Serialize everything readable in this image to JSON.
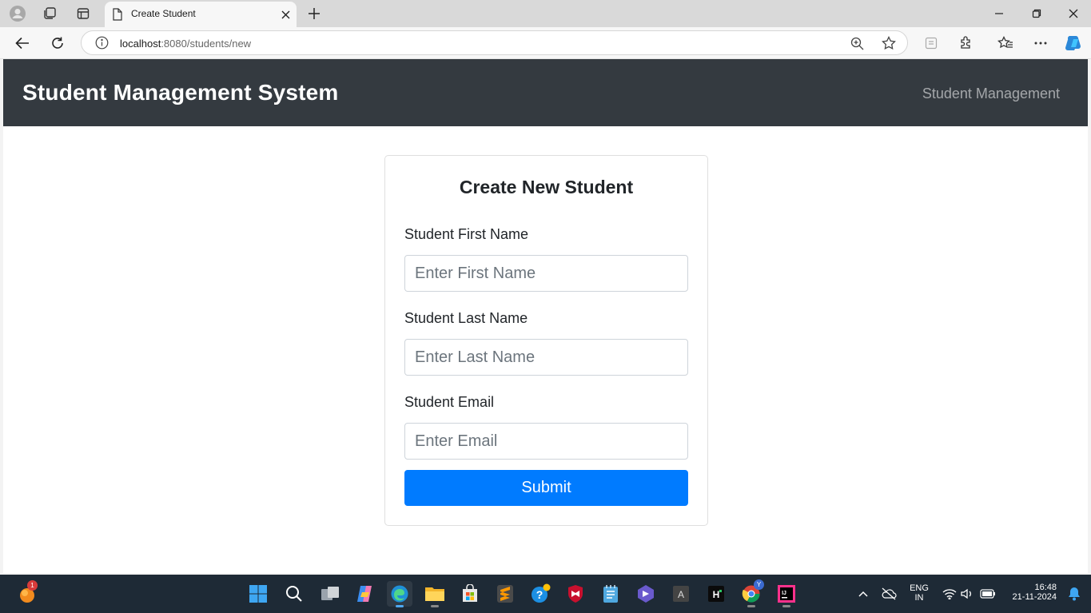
{
  "browser": {
    "tab_title": "Create Student",
    "url_host": "localhost",
    "url_rest": ":8080/students/new"
  },
  "page": {
    "brand": "Student Management System",
    "nav_link": "Student Management",
    "card_title": "Create New Student",
    "first_name_label": "Student First Name",
    "first_name_placeholder": "Enter First Name",
    "last_name_label": "Student Last Name",
    "last_name_placeholder": "Enter Last Name",
    "email_label": "Student Email",
    "email_placeholder": "Enter Email",
    "submit_label": "Submit"
  },
  "taskbar": {
    "notification_count": "1",
    "lang_line1": "ENG",
    "lang_line2": "IN",
    "time": "16:48",
    "date": "21-11-2024",
    "edge_badge": "Y"
  },
  "colors": {
    "navbar": "#343a40",
    "primary": "#007bff",
    "taskbar": "#1e2a36"
  }
}
